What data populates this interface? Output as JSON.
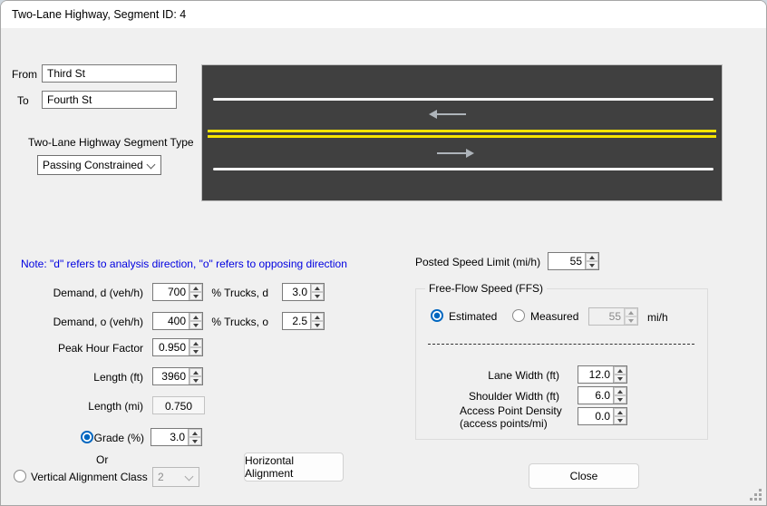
{
  "window": {
    "title": "Two-Lane Highway, Segment ID: 4"
  },
  "route": {
    "from_label": "From",
    "from_value": "Third St",
    "to_label": "To",
    "to_value": "Fourth St"
  },
  "segment_type": {
    "label": "Two-Lane Highway Segment Type",
    "value": "Passing Constrained"
  },
  "road_image": {
    "description": "two-lane road with double yellow centerline and opposing direction arrows",
    "road_color": "#404040",
    "edge_line_color": "#f4f4f4",
    "center_line_color": "#f5e400"
  },
  "note": {
    "text": "Note: \"d\" refers to analysis direction, \"o\" refers to opposing direction",
    "color": "#0000e0"
  },
  "fields": {
    "demand_d": {
      "label": "Demand, d (veh/h)",
      "value": "700"
    },
    "demand_o": {
      "label": "Demand, o (veh/h)",
      "value": "400"
    },
    "trucks_d": {
      "label": "% Trucks, d",
      "value": "3.0"
    },
    "trucks_o": {
      "label": "% Trucks, o",
      "value": "2.5"
    },
    "phf": {
      "label": "Peak Hour Factor",
      "value": "0.950"
    },
    "length_ft": {
      "label": "Length (ft)",
      "value": "3960"
    },
    "length_mi": {
      "label": "Length (mi)",
      "value": "0.750"
    },
    "grade": {
      "label": "Grade (%)",
      "value": "3.0",
      "selected": true
    },
    "or_text": "Or",
    "vertical_alignment": {
      "label": "Vertical Alignment Class",
      "value": "2",
      "selected": false,
      "disabled": true
    }
  },
  "posted_speed": {
    "label": "Posted Speed Limit (mi/h)",
    "value": "55"
  },
  "ffs": {
    "title": "Free-Flow Speed (FFS)",
    "estimated_label": "Estimated",
    "measured_label": "Measured",
    "selected_mode": "Estimated",
    "value": "55",
    "unit": "mi/h",
    "lane_width": {
      "label": "Lane Width (ft)",
      "value": "12.0"
    },
    "shoulder_width": {
      "label": "Shoulder Width (ft)",
      "value": "6.0"
    },
    "access_density": {
      "label_line1": "Access Point Density",
      "label_line2": "(access points/mi)",
      "value": "0.0"
    }
  },
  "buttons": {
    "horizontal_alignment": "Horizontal Alignment",
    "close": "Close"
  },
  "colors": {
    "accent": "#0067c0",
    "dialog_bg": "#f0f0f0",
    "titlebar_bg": "#ffffff"
  }
}
